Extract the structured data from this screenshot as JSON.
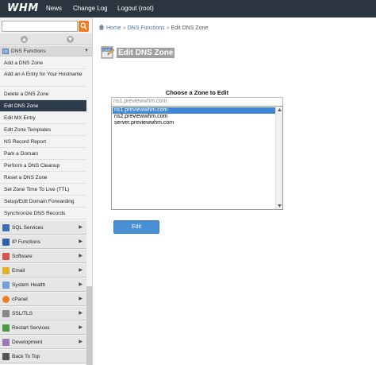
{
  "topbar": {
    "logo": "WHM",
    "nav": [
      "News",
      "Change Log",
      "Logout (root)"
    ]
  },
  "sidebar": {
    "search_value": "",
    "dns_header": "DNS Functions",
    "items": [
      "Add a DNS Zone",
      "Add an A Entry for Your Hostname",
      "Delete a DNS Zone",
      "Edit DNS Zone",
      "Edit MX Entry",
      "Edit Zone Templates",
      "NS Record Report",
      "Park a Domain",
      "Perform a DNS Cleanup",
      "Reset a DNS Zone",
      "Set Zone Time To Live (TTL)",
      "Setup/Edit Domain Forwarding",
      "Synchronize DNS Records"
    ],
    "active_item": "Edit DNS Zone",
    "sections": [
      {
        "label": "SQL Services",
        "icon": "database-icon"
      },
      {
        "label": "IP Functions",
        "icon": "ip-icon"
      },
      {
        "label": "Software",
        "icon": "software-icon"
      },
      {
        "label": "Email",
        "icon": "email-icon"
      },
      {
        "label": "System Health",
        "icon": "health-icon"
      },
      {
        "label": "cPanel",
        "icon": "cpanel-icon"
      },
      {
        "label": "SSL/TLS",
        "icon": "ssl-icon"
      },
      {
        "label": "Restart Services",
        "icon": "restart-icon"
      },
      {
        "label": "Development",
        "icon": "development-icon"
      },
      {
        "label": "Back To Top",
        "icon": "back-to-top-icon"
      }
    ]
  },
  "breadcrumb": {
    "home": "Home",
    "section": "DNS Functions",
    "current": "Edit DNS Zone"
  },
  "page": {
    "title": "Edit DNS Zone",
    "title_icon_text": "DNS",
    "zone_label": "Choose a Zone to Edit",
    "filter_value": "ns1.previewwhm.com",
    "zones": [
      "ns1.previewwhm.com",
      "ns2.previewwhm.com",
      "server.previewwhm.com"
    ],
    "selected_zone": "ns1.previewwhm.com",
    "edit_button": "Edit"
  },
  "colors": {
    "topbar": "#2b3540",
    "active_item": "#2e3b4a",
    "search_button": "#f07c24",
    "selection": "#3d85d6",
    "button": "#4a8fd4"
  }
}
